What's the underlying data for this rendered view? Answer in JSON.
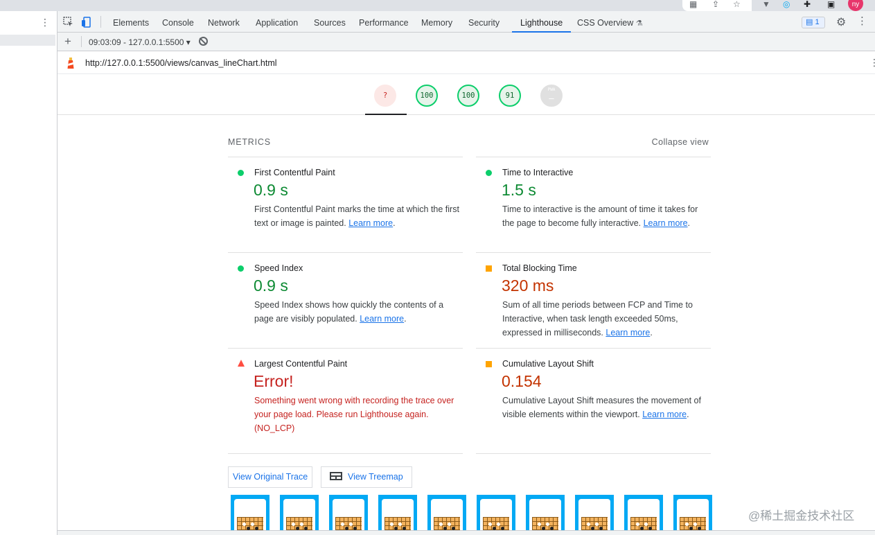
{
  "devtools_tabs": [
    "Elements",
    "Console",
    "Network",
    "Application",
    "Sources",
    "Performance",
    "Memory",
    "Security",
    "Lighthouse",
    "CSS Overview"
  ],
  "issues_count": "1",
  "report_selector": "09:03:09 - 127.0.0.1:5500 ▾",
  "url": "http://127.0.0.1:5500/views/canvas_lineChart.html",
  "gauges": [
    {
      "label": "?",
      "status": "error"
    },
    {
      "label": "100",
      "status": "pass"
    },
    {
      "label": "100",
      "status": "pass"
    },
    {
      "label": "91",
      "status": "pass"
    },
    {
      "label": "PWA",
      "status": "na"
    }
  ],
  "metrics_header": "METRICS",
  "collapse_view": "Collapse view",
  "metrics": [
    {
      "title": "First Contentful Paint",
      "value": "0.9 s",
      "status": "pass",
      "desc": "First Contentful Paint marks the time at which the first text or image is painted.",
      "link": "Learn more",
      "after": "."
    },
    {
      "title": "Time to Interactive",
      "value": "1.5 s",
      "status": "pass",
      "desc": "Time to interactive is the amount of time it takes for the page to become fully interactive.",
      "link": "Learn more",
      "after": "."
    },
    {
      "title": "Speed Index",
      "value": "0.9 s",
      "status": "pass",
      "desc": "Speed Index shows how quickly the contents of a page are visibly populated.",
      "link": "Learn more",
      "after": "."
    },
    {
      "title": "Total Blocking Time",
      "value": "320 ms",
      "status": "avg",
      "desc": "Sum of all time periods between FCP and Time to Interactive, when task length exceeded 50ms, expressed in milliseconds.",
      "link": "Learn more",
      "after": "."
    },
    {
      "title": "Largest Contentful Paint",
      "value": "Error!",
      "status": "fail",
      "desc": "Something went wrong with recording the trace over your page load. Please run Lighthouse again. (NO_LCP)",
      "link": "",
      "after": ""
    },
    {
      "title": "Cumulative Layout Shift",
      "value": "0.154",
      "status": "avg",
      "desc": "Cumulative Layout Shift measures the movement of visible elements within the viewport.",
      "link": "Learn more",
      "after": "."
    }
  ],
  "buttons": {
    "view_trace": "View Original Trace",
    "view_treemap": "View Treemap"
  },
  "thumbnail_count": 10,
  "watermark": "@稀土掘金技术社区",
  "colors": {
    "pass": "#0cce6b",
    "average": "#ffa400",
    "fail": "#ff4e42",
    "accent": "#1a73e8"
  }
}
